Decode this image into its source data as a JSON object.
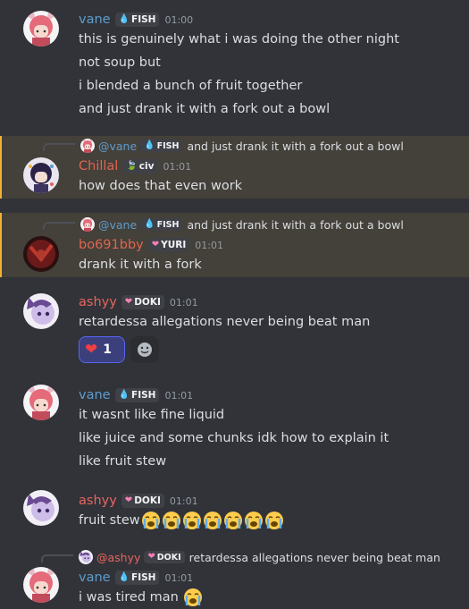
{
  "colors": {
    "vane": "#5e9ccc",
    "chillal": "#e0654f",
    "bo691bby": "#e0654f",
    "ashyy": "#e9655f",
    "highlight_bg": "#44403a",
    "highlight_border": "#f0b232"
  },
  "messages": [
    {
      "username": "vane",
      "tag": "FISH",
      "tag_icon": "water-drop-icon",
      "time": "01:00",
      "lines": [
        "this is genuinely what i was doing the other night",
        "not soup but",
        "i blended a bunch of fruit together",
        "and just drank it with a fork out a bowl"
      ]
    },
    {
      "reply": {
        "username": "@vane",
        "tag": "FISH",
        "text": "and just drank it with a fork out a bowl"
      },
      "username": "Chillal",
      "tag": "civ",
      "tag_icon": "leaf-icon",
      "time": "01:01",
      "lines": [
        "how does that even work"
      ]
    },
    {
      "reply": {
        "username": "@vane",
        "tag": "FISH",
        "text": "and just drank it with a fork out a bowl"
      },
      "username": "bo691bby",
      "tag": "YURI",
      "tag_icon": "heart-icon",
      "time": "01:01",
      "lines": [
        "drank it with a fork"
      ]
    },
    {
      "username": "ashyy",
      "tag": "DOKI",
      "tag_icon": "heart-icon",
      "time": "01:01",
      "lines": [
        "retardessa allegations never being beat man"
      ],
      "reaction": {
        "emoji": "heart-icon",
        "count": "1"
      }
    },
    {
      "username": "vane",
      "tag": "FISH",
      "tag_icon": "water-drop-icon",
      "time": "01:01",
      "lines": [
        "it wasnt like fine liquid",
        "like juice and some chunks idk how to explain it",
        "like fruit stew"
      ]
    },
    {
      "username": "ashyy",
      "tag": "DOKI",
      "tag_icon": "heart-icon",
      "time": "01:01",
      "lines": [
        "fruit stew"
      ],
      "emoji_count": 7
    },
    {
      "reply": {
        "username": "@ashyy",
        "tag": "DOKI",
        "text": "retardessa allegations never being beat man"
      },
      "username": "vane",
      "tag": "FISH",
      "tag_icon": "water-drop-icon",
      "time": "01:01",
      "lines": [
        "i was tired man"
      ],
      "emoji_count": 1
    }
  ]
}
